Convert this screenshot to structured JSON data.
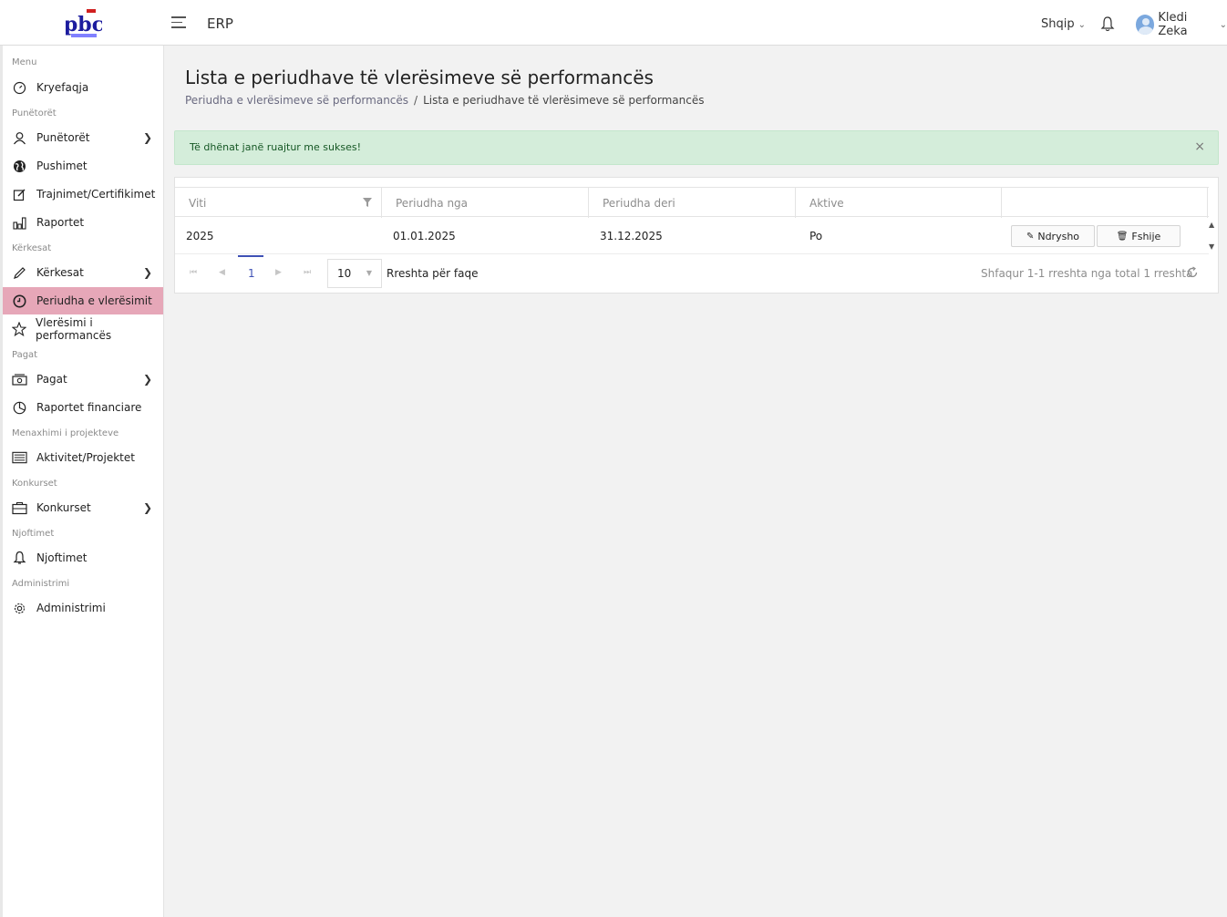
{
  "header": {
    "app_title": "ERP",
    "language": "Shqip",
    "user_name": "Kledi Zeka"
  },
  "sidebar": {
    "sections": [
      "Menu",
      "Punëtorët",
      "Kërkesat",
      "Pagat",
      "Menaxhimi i projekteve",
      "Konkurset",
      "Njoftimet",
      "Administrimi"
    ],
    "items": [
      {
        "label": "Kryefaqja",
        "icon": "dashboard-icon"
      },
      {
        "label": "Punëtorët",
        "icon": "user-icon",
        "has_children": true
      },
      {
        "label": "Pushimet",
        "icon": "globe-icon"
      },
      {
        "label": "Trajnimet/Certifikimet",
        "icon": "edit-icon"
      },
      {
        "label": "Raportet",
        "icon": "bar-chart-icon"
      },
      {
        "label": "Kërkesat",
        "icon": "pencil-icon",
        "has_children": true
      },
      {
        "label": "Periudha e vlerësimit",
        "icon": "clock-icon",
        "active": true
      },
      {
        "label": "Vlerësimi i performancës",
        "icon": "star-icon"
      },
      {
        "label": "Pagat",
        "icon": "money-icon",
        "has_children": true
      },
      {
        "label": "Raportet financiare",
        "icon": "pie-chart-icon"
      },
      {
        "label": "Aktivitet/Projektet",
        "icon": "list-icon"
      },
      {
        "label": "Konkurset",
        "icon": "briefcase-icon",
        "has_children": true
      },
      {
        "label": "Njoftimet",
        "icon": "bell-icon"
      },
      {
        "label": "Administrimi",
        "icon": "settings-icon"
      }
    ]
  },
  "page": {
    "title": "Lista e periudhave të vlerësimeve së performancës",
    "breadcrumb_parent": "Periudha e vlerësimeve së performancës",
    "breadcrumb_separator": "/",
    "breadcrumb_current": "Lista e periudhave të vlerësimeve së performancës"
  },
  "alert": {
    "message": "Të dhënat janë ruajtur me sukses!",
    "close": "×",
    "color": "#d4edda"
  },
  "table": {
    "columns": [
      "Viti",
      "Periudha nga",
      "Periudha deri",
      "Aktive",
      ""
    ],
    "rows": [
      {
        "viti": "2025",
        "nga": "01.01.2025",
        "deri": "31.12.2025",
        "aktive": "Po"
      }
    ],
    "edit_label": "Ndrysho",
    "delete_label": "Fshije"
  },
  "pager": {
    "current_page": "1",
    "page_size": "10",
    "page_size_label": "Rreshta për faqe",
    "info": "Shfaqur 1-1 rreshta nga total 1 rreshta"
  },
  "colors": {
    "active_menu": "#e6a7b8",
    "pager_accent": "#3f51b5",
    "success_text": "#155724"
  }
}
